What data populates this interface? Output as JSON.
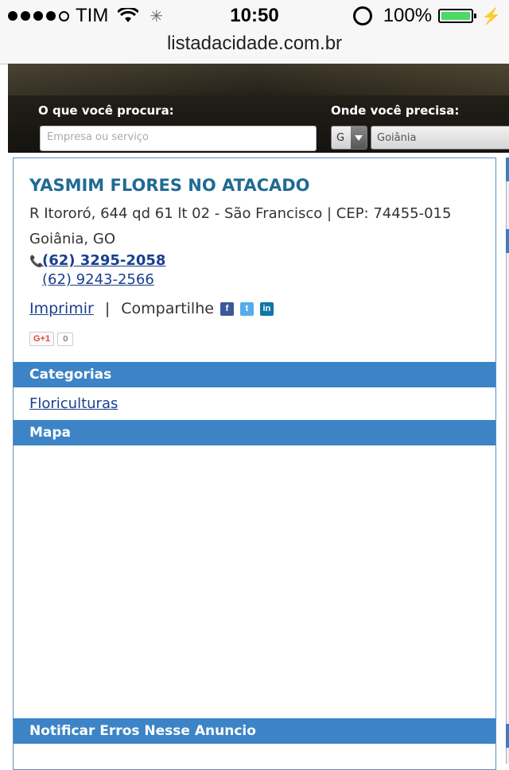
{
  "status_bar": {
    "carrier": "TIM",
    "time": "10:50",
    "battery": "100%",
    "battery_level": 1.0
  },
  "browser": {
    "url": "listadacidade.com.br"
  },
  "search": {
    "what_label": "O que você procura:",
    "what_placeholder": "Empresa ou serviço",
    "where_label": "Onde você precisa:",
    "state_value": "G",
    "city_value": "Goiânia"
  },
  "business": {
    "name": "YASMIM FLORES NO ATACADO",
    "address_line1": "R Itororó, 644 qd 61 lt 02 - São Francisco  | CEP: 74455-015",
    "address_line2": "Goiânia, GO",
    "phone1": "(62) 3295-2058",
    "phone2": "(62) 9243-2566",
    "print_label": "Imprimir",
    "separator": "|",
    "share_label": "Compartilhe",
    "gplus_label": "G+1",
    "gplus_count": "0"
  },
  "sections": {
    "categories_title": "Categorias",
    "category_link": "Floriculturas",
    "map_title": "Mapa",
    "report_title": "Notificar Erros Nesse Anuncio"
  },
  "colors": {
    "accent": "#3c84c6",
    "title": "#1f6b93",
    "link": "#1a3f8f"
  }
}
